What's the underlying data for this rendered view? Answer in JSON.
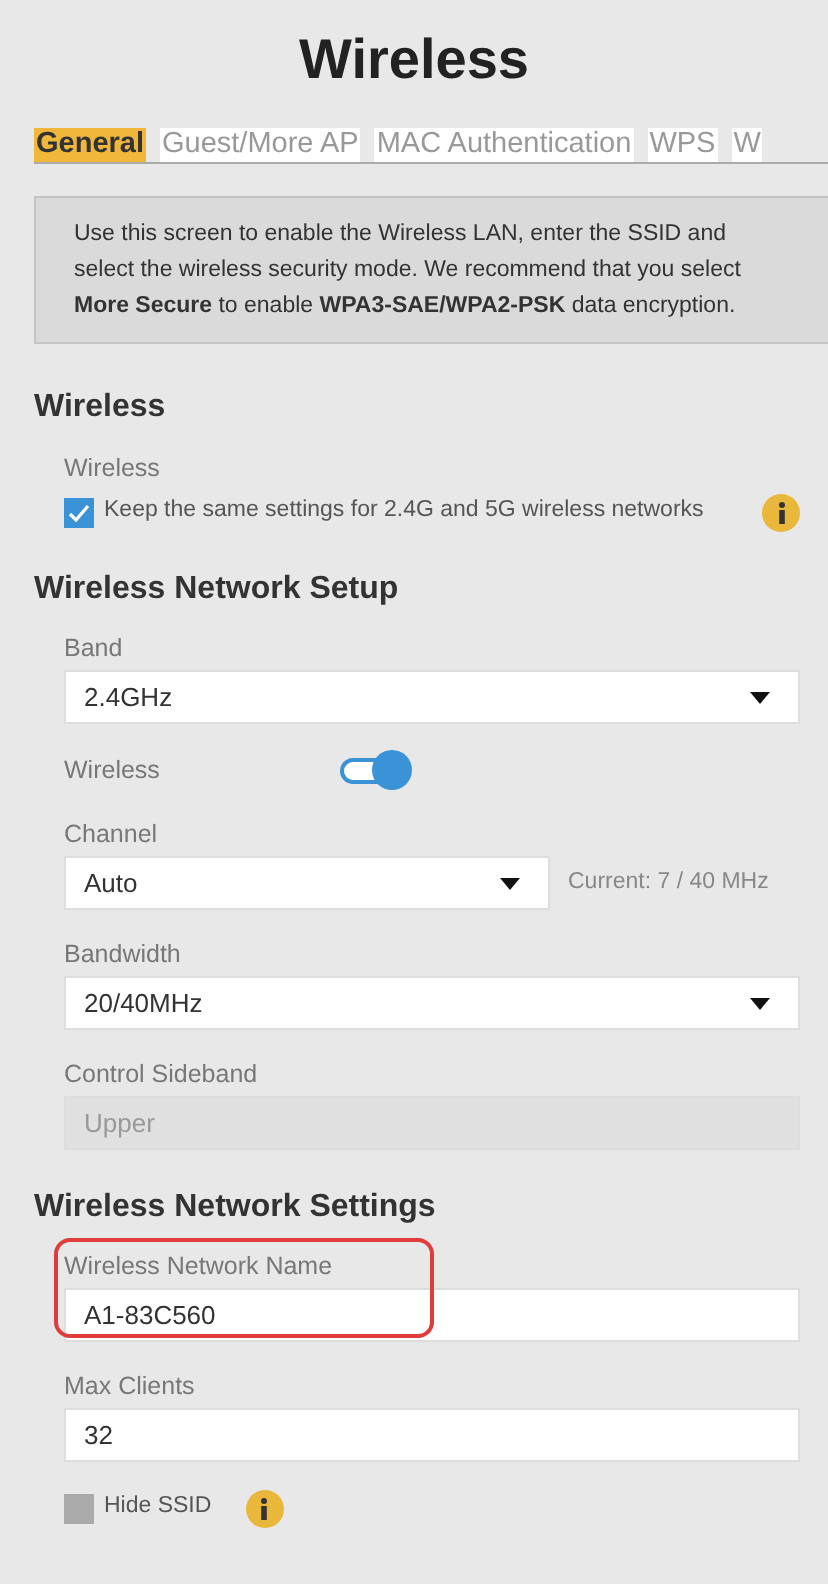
{
  "title": "Wireless",
  "tabs": [
    {
      "label": "General",
      "selected": true
    },
    {
      "label": "Guest/More AP",
      "selected": false
    },
    {
      "label": "MAC Authentication",
      "selected": false
    },
    {
      "label": "WPS",
      "selected": false
    },
    {
      "label": "W",
      "selected": false
    }
  ],
  "intro": "Use this screen to enable the Wireless LAN, enter the SSID and select the wireless security mode. We recommend that you select **More Secure** to enable **WPA3-SAE/WPA2-PSK** data encryption.",
  "sections": [
    {
      "heading": "Wireless",
      "items": [
        {
          "kind": "label",
          "label": "Wireless"
        },
        {
          "kind": "checkbox",
          "label": "Keep the same settings for 2.4G and 5G wireless networks",
          "checked": true,
          "info": true
        }
      ]
    },
    {
      "heading": "Wireless Network Setup",
      "items": [
        {
          "kind": "select",
          "label": "Band",
          "value": "2.4GHz"
        },
        {
          "kind": "toggle",
          "label": "Wireless",
          "on": true
        },
        {
          "kind": "select",
          "label": "Channel",
          "value": "Auto",
          "note": "Current: 7 / 40 MHz"
        },
        {
          "kind": "select",
          "label": "Bandwidth",
          "value": "20/40MHz"
        },
        {
          "kind": "text",
          "label": "Control Sideband",
          "value": "Upper",
          "disabled": true,
          "highlighted": false
        }
      ]
    },
    {
      "heading": "Wireless Network Settings",
      "items": [
        {
          "kind": "text",
          "label": "Wireless Network Name",
          "value": "A1-83C560",
          "disabled": false,
          "highlighted": true
        },
        {
          "kind": "text",
          "label": "Max Clients",
          "value": "32",
          "disabled": false,
          "highlighted": false
        },
        {
          "kind": "checkbox",
          "label": "Hide SSID",
          "checked": false,
          "info": true
        }
      ]
    }
  ]
}
